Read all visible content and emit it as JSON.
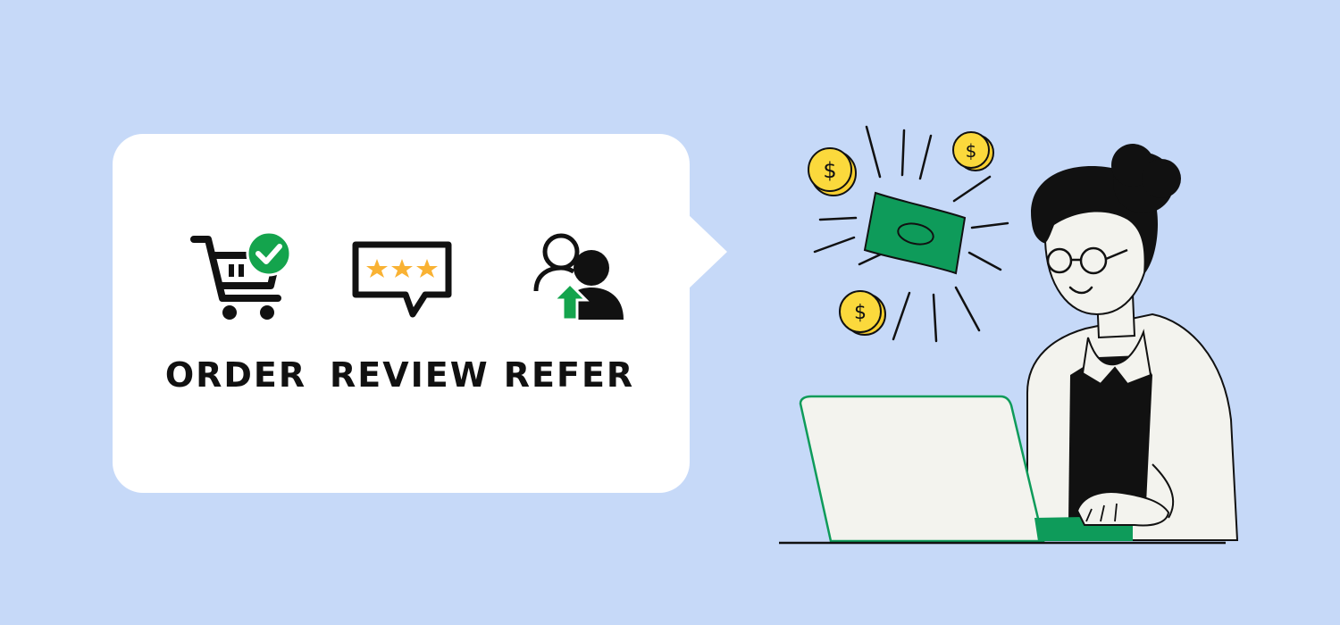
{
  "steps": [
    {
      "label": "ORDER",
      "icon": "cart-check-icon"
    },
    {
      "label": "REVIEW",
      "icon": "star-review-bubble-icon"
    },
    {
      "label": "REFER",
      "icon": "refer-friend-icon"
    }
  ],
  "colors": {
    "background": "#c6d9f8",
    "bubble": "#ffffff",
    "accent_green": "#14a44d",
    "money_green": "#0e9b5a",
    "coin_yellow": "#f7cf2f",
    "star_orange": "#f9b233",
    "ink": "#111111"
  }
}
